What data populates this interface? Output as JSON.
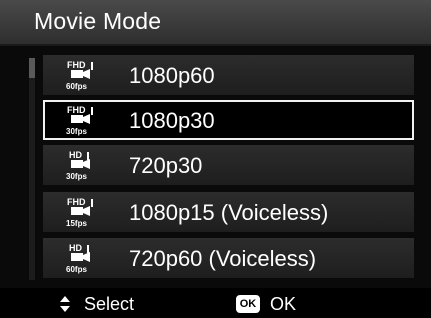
{
  "title": "Movie Mode",
  "menu": {
    "items": [
      {
        "label": "1080p60",
        "icon_top": "FHD",
        "icon_bottom": "60fps",
        "icon": "fhd-60fps-movie-icon",
        "selected": false
      },
      {
        "label": "1080p30",
        "icon_top": "FHD",
        "icon_bottom": "30fps",
        "icon": "fhd-30fps-movie-icon",
        "selected": true
      },
      {
        "label": "720p30",
        "icon_top": "HD",
        "icon_bottom": "30fps",
        "icon": "hd-30fps-movie-icon",
        "selected": false
      },
      {
        "label": "1080p15 (Voiceless)",
        "icon_top": "FHD",
        "icon_bottom": "15fps",
        "icon": "fhd-15fps-movie-icon",
        "selected": false
      },
      {
        "label": "720p60 (Voiceless)",
        "icon_top": "HD",
        "icon_bottom": "60fps",
        "icon": "hd-60fps-movie-icon",
        "selected": false
      }
    ]
  },
  "footer": {
    "select_icon": "up-down-arrows-icon",
    "select_label": "Select",
    "ok_icon_text": "OK",
    "ok_label": "OK"
  },
  "colors": {
    "highlight_border": "#f2f2f2",
    "item_background": "#262626",
    "title_background": "#3c3c3c"
  }
}
